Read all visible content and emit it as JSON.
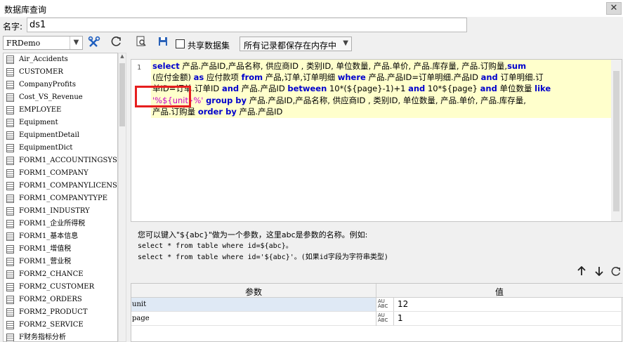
{
  "window": {
    "title": "数据库查询",
    "close_label": "✕"
  },
  "name_row": {
    "label": "名字:",
    "value": "ds1"
  },
  "left_panel": {
    "connection": "FRDemo",
    "tables": [
      "Air_Accidents",
      "CUSTOMER",
      "CompanyProfits",
      "Cost_VS_Revenue",
      "EMPLOYEE",
      "Equipment",
      "EquipmentDetail",
      "EquipmentDict",
      "FORM1_ACCOUNTINGSYSTEM",
      "FORM1_COMPANY",
      "FORM1_COMPANYLICENSE",
      "FORM1_COMPANYTYPE",
      "FORM1_INDUSTRY",
      "FORM1_企业所得税",
      "FORM1_基本信息",
      "FORM1_增值税",
      "FORM1_营业税",
      "FORM2_CHANCE",
      "FORM2_CUSTOMER",
      "FORM2_ORDERS",
      "FORM2_PRODUCT",
      "FORM2_SERVICE",
      "F财务指标分析"
    ]
  },
  "toolbar": {
    "share_label": "共享数据集",
    "cache_option": "所有记录都保存在内存中"
  },
  "editor": {
    "line_number": "1",
    "sql_lines": [
      [
        [
          "kw",
          "select"
        ],
        [
          "t",
          " 产品.产品ID,产品名称, 供应商ID , 类别ID, 单位数量, 产品.单价, 产品.库存量, 产品.订购量,"
        ],
        [
          "kw",
          "sum"
        ]
      ],
      [
        [
          "t",
          "(应付金额) "
        ],
        [
          "kw",
          "as"
        ],
        [
          "t",
          " 应付款项 "
        ],
        [
          "kw",
          "from"
        ],
        [
          "t",
          " 产品,订单,订单明细 "
        ],
        [
          "kw",
          "where"
        ],
        [
          "t",
          " 产品.产品ID=订单明细.产品ID "
        ],
        [
          "kw",
          "and"
        ],
        [
          "t",
          " 订单明细.订"
        ]
      ],
      [
        [
          "t",
          "单ID=订单.订单ID "
        ],
        [
          "kw",
          "and"
        ],
        [
          "t",
          " 产品.产品ID  "
        ],
        [
          "kw",
          "between"
        ],
        [
          "t",
          " 10*(${page}-1)+1 "
        ],
        [
          "kw",
          "and"
        ],
        [
          "t",
          " 10*${page} "
        ],
        [
          "kw",
          "and"
        ],
        [
          "t",
          " 单位数量 "
        ],
        [
          "kw",
          "like"
        ]
      ],
      [
        [
          "str",
          "'%${unit}%'"
        ],
        [
          "t",
          " "
        ],
        [
          "kw",
          "group by"
        ],
        [
          "t",
          " 产品.产品ID,产品名称, 供应商ID , 类别ID, 单位数量, 产品.单价, 产品.库存量,"
        ]
      ],
      [
        [
          "t",
          "产品.订购量 "
        ],
        [
          "kw",
          "order by"
        ],
        [
          "t",
          " 产品.产品ID"
        ]
      ]
    ]
  },
  "help": {
    "line1": "您可以键入\"${abc}\"做为一个参数，这里abc是参数的名称。例如:",
    "line2": "select * from table where id=${abc}。",
    "line3": "select * from table where id='${abc}'。(如果id字段为字符串类型)"
  },
  "params": {
    "col_name": "参数",
    "col_value": "值",
    "type_icon": "ABC",
    "rows": [
      {
        "name": "unit",
        "value": "12"
      },
      {
        "name": "page",
        "value": "1"
      }
    ]
  },
  "colors": {
    "keyword": "#0000cc",
    "string": "#c800c8",
    "highlight": "#ffffcc",
    "annotation": "#e61e1e"
  }
}
